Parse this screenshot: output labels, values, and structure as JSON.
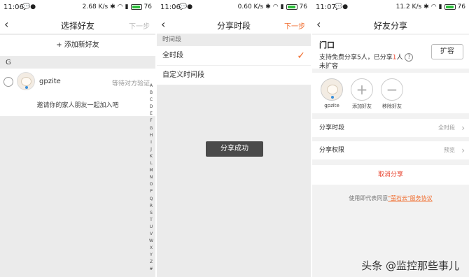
{
  "colors": {
    "accent": "#f06a2a",
    "danger": "#e8412c",
    "battery": "#2dbe3c",
    "toast_bg": "#4a4a4a"
  },
  "screen1": {
    "status": {
      "time": "11:06",
      "net": "2.68 K/s",
      "battery": "76"
    },
    "nav": {
      "back_icon": "chevron-left-icon",
      "title": "选择好友",
      "next": "下一步"
    },
    "add_friend": "+ 添加新好友",
    "section": "G",
    "friend": {
      "name": "gpzite",
      "status": "等待对方验证"
    },
    "invite": "邀请你的家人朋友一起加入吧",
    "alphabet": [
      "A",
      "B",
      "C",
      "D",
      "E",
      "F",
      "G",
      "H",
      "I",
      "J",
      "K",
      "L",
      "M",
      "N",
      "O",
      "P",
      "Q",
      "R",
      "S",
      "T",
      "U",
      "V",
      "W",
      "X",
      "Y",
      "Z",
      "#"
    ]
  },
  "screen2": {
    "status": {
      "time": "11:06",
      "net": "0.60 K/s",
      "battery": "76"
    },
    "nav": {
      "back_icon": "chevron-left-icon",
      "title": "分享时段",
      "done": "下一步"
    },
    "section_label": "时间段",
    "options": [
      {
        "label": "全时段",
        "checked": true
      },
      {
        "label": "自定义时间段",
        "checked": false
      }
    ],
    "toast": "分享成功"
  },
  "screen3": {
    "status": {
      "time": "11:07",
      "net": "11.2 K/s",
      "battery": "76"
    },
    "nav": {
      "back_icon": "chevron-left-icon",
      "title": "好友分享"
    },
    "device_name": "门口",
    "quota": {
      "prefix": "支持免费分享5人，已分享",
      "count": "1",
      "suffix": "人",
      "second_line": "未扩容"
    },
    "help_icon": "?",
    "expand": "扩容",
    "members": [
      {
        "label": "gpzite",
        "kind": "avatar"
      },
      {
        "label": "添加好友",
        "kind": "add"
      },
      {
        "label": "移除好友",
        "kind": "remove"
      }
    ],
    "settings": [
      {
        "label": "分享时段",
        "value": "全时段"
      },
      {
        "label": "分享权限",
        "value": "预览"
      }
    ],
    "cancel": "取消分享",
    "agreement_prefix": "使用即代表同意",
    "agreement_link": "\"萤石云\"服务协议"
  },
  "watermark": "头条 @监控那些事儿"
}
